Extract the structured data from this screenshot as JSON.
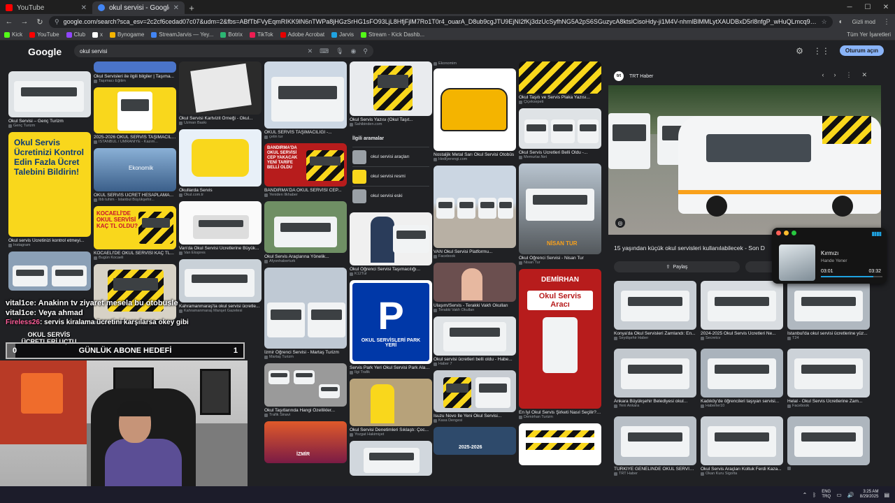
{
  "tabs": [
    {
      "label": "YouTube",
      "color": "#ff0000"
    },
    {
      "label": "okul servisi - Google'da Ara",
      "color": "#4285f4"
    }
  ],
  "url": "google.com/search?sca_esv=2c2cf6cedad07c07&udm=2&fbs=ABfTbFVyEqmRIKK9lN6nTWPa8jHGzSrHG1sFO93LjL8HfjFjlM7Ro1T0r4_ouarA_D8ub9cgJTU9EjNI2fKj3dzUcSyfhNG5A2pS6SGuzycA8ktslCisoHdy-ji1M4V-nhmlBlMMLytXAUDBxD5rl8nfgP_wHuQLmcq990p_2nSCqFR7MmA2ALe5gXCmtbJIedn",
  "profile": "Gizli mod",
  "bookmarks": [
    {
      "label": "Kick",
      "color": "#53fc18"
    },
    {
      "label": "YouTube",
      "color": "#ff0000"
    },
    {
      "label": "Club",
      "color": "#9146ff"
    },
    {
      "label": "x",
      "color": "#ffffff"
    },
    {
      "label": "Bynogame",
      "color": "#f4b400"
    },
    {
      "label": "StreamJarvis — Yey...",
      "color": "#4285f4"
    },
    {
      "label": "Botrix",
      "color": "#2bb673"
    },
    {
      "label": "TikTok",
      "color": "#ee1d52"
    },
    {
      "label": "Adobe Acrobat",
      "color": "#e60000"
    },
    {
      "label": "Jarvis",
      "color": "#1fa2e0"
    },
    {
      "label": "Stream - Kick Dashb...",
      "color": "#53fc18"
    }
  ],
  "all_bookmarks": "Tüm Yer İşaretleri",
  "google": {
    "logo": "Google",
    "query": "okul servisi",
    "signin": "Oturum açın"
  },
  "results": {
    "c1": [
      {
        "cap": "Okul Servisi – Genç Turizm",
        "src": "Genç Turizm"
      },
      {
        "cap": "Okul servis Ücretinizi kontrol etmeyi...",
        "src": "Instagram"
      },
      {
        "cap": "",
        "src": ""
      }
    ],
    "c2": [
      {
        "cap": "Okul Servisleri ile ilgili bilgiler | Taşıma...",
        "src": "Taşımacı Eğitim"
      },
      {
        "cap": "2025-2026 OKUL SERVİS TAŞIMACILI...",
        "src": "İSTANBUL / ÜMRANİYE - Kazım..."
      },
      {
        "cap": "OKUL SERVİS ÜCRET HESAPLAMA...",
        "src": "Ibb tuhim - İstanbul Büyükşehir..."
      },
      {
        "cap": "KOCAELİ'DE OKUL SERVİSİ KAÇ TL...",
        "src": "Bugün Kocaeli"
      },
      {
        "cap": "",
        "src": "Sahibinden.com"
      }
    ],
    "c3": [
      {
        "cap": "Okul Servisi Kartvizit Örneği - Okul...",
        "src": "Uzman Baskı"
      },
      {
        "cap": "Okullarda Servis",
        "src": "Okul.com.tr"
      },
      {
        "cap": "Van'da Okul Servisi Ücretlerine Büyük...",
        "src": "Van Ekspres"
      },
      {
        "cap": "Kahramanmaraş'ta okul servisi ücretle...",
        "src": "Kahramanmaraş Manşet Gazetesi"
      }
    ],
    "c4": [
      {
        "cap": "OKUL SERVİS TAŞIMACILIĞI -...",
        "src": "çetin tur"
      },
      {
        "cap": "BANDIRMA'DA OKUL SERVİSİ CEP...",
        "src": "Yeniden İlkhaber"
      },
      {
        "cap": "Okul Servis Araçlarına Yönelik...",
        "src": "Afyonhaberturk"
      },
      {
        "cap": "İzmir Öğrenci Servisi - Martaş Turizm",
        "src": "Martaş Turizm"
      },
      {
        "cap": "Okul Taşıtlarında Hangi Özellikler...",
        "src": "Trafik Sinavi"
      }
    ],
    "c5": [
      {
        "cap": "Okul Servis Yazısı (Okul Taşıt...",
        "src": "Sahibinden.com"
      },
      {
        "cap": "Okul Öğrenci Servisi Taşımacılığı...",
        "src": "K12Tur"
      },
      {
        "cap": "Servis Park Yeri Okul Servisi Park Alanı...",
        "src": "İlgi Trafik"
      },
      {
        "cap": "Okul Servisi Denetimleri Sıklaştı: Çoc...",
        "src": "Yozgat Hakimiyet"
      }
    ],
    "related": {
      "title": "İlgili aramalar",
      "items": [
        "okul servisi araçları",
        "okul servisi resmi",
        "okul servisi eski"
      ]
    },
    "c6": [
      {
        "cap": "",
        "src": "Ekonomim"
      },
      {
        "cap": "Nostaljik Metal Sarı Okul Servisi Otobüs",
        "src": "Hediyerengi.com"
      },
      {
        "cap": "VAN Okul Servisi Platformu...",
        "src": "Facebook"
      },
      {
        "cap": "Ulaşım/Servis - Terakki Vakfı Okulları",
        "src": "Terakki Vakfı Okulları"
      },
      {
        "cap": "Okul servisi ücretleri belli oldu - Habe...",
        "src": "Haber 7"
      },
      {
        "cap": "Isuzu Novo İle Yeni Okul Servisi...",
        "src": "Kasa Dengesi"
      }
    ],
    "c7": [
      {
        "cap": "Okul Taşıtı ve Servis Plaka Yazısı...",
        "src": "Çiçeksepeti"
      },
      {
        "cap": "Okul Servis Ücretleri Belli Oldu -...",
        "src": "Memurlar.Net"
      },
      {
        "cap": "Okul Öğrenci Servisi - Nisan Tur",
        "src": "Nisan Tur"
      },
      {
        "cap": "En İyi Okul Servis Şirketi Nasıl Seçilir? ...",
        "src": "Demirhan Turizm"
      }
    ]
  },
  "overlay_text": {
    "okul_tasiti": "OKUL TAŞITI",
    "bandirma": "BANDIRMA'DA OKUL SERVİSİ CEP YAKACAK YENİ TARİFE BELLİ OLDU",
    "kocaeli": "KOCAELİ'DE OKUL SERVİSİ KAÇ TL OLDU?",
    "okul_servis_ucretleri": "OKUL SERVİS ÜCRETLERİ UÇTU",
    "ekonomik": "Ekonomik",
    "park_letter": "P",
    "park_text": "OKUL SERVİSLERİ PARK YERİ",
    "demirhan": "DEMİRHAN",
    "demirhan_sub": "Okul Servis Aracı",
    "promo": "Okul Servis Ücretinizi Kontrol Edin Fazla Ücret Talebini Bildirin!",
    "nisan": "NİSAN TUR",
    "izmir": "İZMİR",
    "year": "2025-2026"
  },
  "panel": {
    "source": "TRT Haber",
    "title": "15 yaşından küçük okul servisleri kullanılabilecek - Son D",
    "share": "Paylaş",
    "thumbs": [
      {
        "cap": "Konya'da Okul Servisleri Zamlandı: En...",
        "src": "Seydişehir Haber"
      },
      {
        "cap": "2024-2025 Okul Servis Ücretleri Ne...",
        "src": "Secretcv"
      },
      {
        "cap": "İstanbul'da okul servisi ücretlerine yüz...",
        "src": "T24"
      },
      {
        "cap": "Ankara Büyükşehir Belediyesi okul...",
        "src": "Yeni Ankara"
      },
      {
        "cap": "Kadıköy'de öğrencileri taşıyan servisi...",
        "src": "Haberler10"
      },
      {
        "cap": "Helal - Okul Servis Ücretlerine Zam...",
        "src": "Facebook"
      },
      {
        "cap": "TÜRKİYE GENELİNDE OKUL SERVİSİ...",
        "src": "TRT Haber"
      },
      {
        "cap": "Okul Servis Araçları Koltuk Ferdi Kaza...",
        "src": "Okan Kuru Sigorta"
      },
      {
        "cap": "",
        "src": ""
      }
    ]
  },
  "music": {
    "title": "Kırmızı",
    "artist": "Hande Yener",
    "elapsed": "03:01",
    "total": "03:32",
    "progress": 0.85
  },
  "chat": [
    {
      "user": "vital1ce",
      "msg": ": Anakinn tv ziyaret mesela bu otobusle"
    },
    {
      "user": "vital1ce",
      "msg": ": Veya ahmad"
    },
    {
      "user": "Fireless26",
      "msg": ": servis kiralama ücretini karşılarsa okey gibi"
    }
  ],
  "subgoal": {
    "left": "0",
    "label": "GÜNLÜK ABONE HEDEFİ",
    "right": "1",
    "progress": 0.0
  },
  "taskbar": {
    "lang1": "ENG",
    "lang2": "TRQ",
    "time": "3:25 AM",
    "date": "8/29/2025"
  }
}
